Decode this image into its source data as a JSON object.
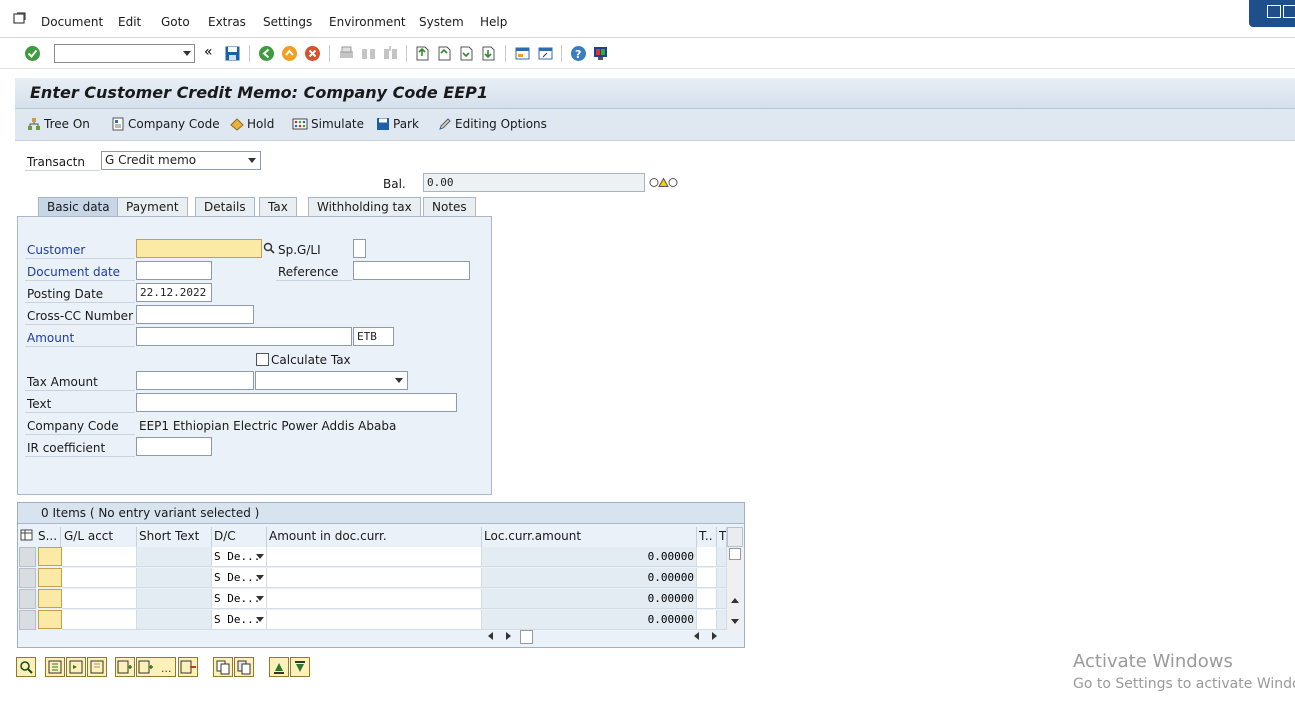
{
  "menu": {
    "items": [
      "Document",
      "Edit",
      "Goto",
      "Extras",
      "Settings",
      "Environment",
      "System",
      "Help"
    ]
  },
  "toolbar": {
    "command_value": "",
    "icons": [
      "enter-icon",
      "back-double-icon",
      "save-icon",
      "back-icon",
      "exit-icon",
      "cancel-icon",
      "print-icon",
      "find-icon",
      "find-next-icon",
      "first-page-icon",
      "prev-page-icon",
      "next-page-icon",
      "last-page-icon",
      "new-session-icon",
      "shortcut-icon",
      "help-icon",
      "customize-layout-icon"
    ]
  },
  "title": "Enter Customer Credit Memo: Company Code EEP1",
  "app_toolbar": {
    "tree_on": "Tree On",
    "company_code": "Company Code",
    "hold": "Hold",
    "simulate": "Simulate",
    "park": "Park",
    "editing_options": "Editing Options"
  },
  "header": {
    "transactn_label": "Transactn",
    "transactn_value": "G Credit memo",
    "bal_label": "Bal.",
    "bal_value": "0.00"
  },
  "tabs": [
    "Basic data",
    "Payment",
    "Details",
    "Tax",
    "Withholding tax",
    "Notes"
  ],
  "basic_data": {
    "customer_label": "Customer",
    "customer_value": "",
    "spgl_label": "Sp.G/LI",
    "doc_date_label": "Document date",
    "doc_date_value": "",
    "reference_label": "Reference",
    "reference_value": "",
    "posting_date_label": "Posting Date",
    "posting_date_value": "22.12.2022",
    "cross_cc_label": "Cross-CC Number",
    "amount_label": "Amount",
    "amount_value": "",
    "currency": "ETB",
    "calc_tax_label": "Calculate Tax",
    "tax_amount_label": "Tax Amount",
    "text_label": "Text",
    "company_code_label": "Company Code",
    "company_code_value": "EEP1 Ethiopian Electric Power Addis Ababa",
    "ir_coeff_label": "IR coefficient"
  },
  "items": {
    "header": "0 Items ( No entry variant selected )",
    "columns": [
      "S...",
      "G/L acct",
      "Short Text",
      "D/C",
      "Amount in doc.curr.",
      "Loc.curr.amount",
      "T..",
      "T"
    ],
    "rows": [
      {
        "dc": "S De...",
        "loc_amount": "0.00000"
      },
      {
        "dc": "S De...",
        "loc_amount": "0.00000"
      },
      {
        "dc": "S De...",
        "loc_amount": "0.00000"
      },
      {
        "dc": "S De...",
        "loc_amount": "0.00000"
      }
    ]
  },
  "watermark": {
    "line1": "Activate Windows",
    "line2": "Go to Settings to activate Windows."
  }
}
